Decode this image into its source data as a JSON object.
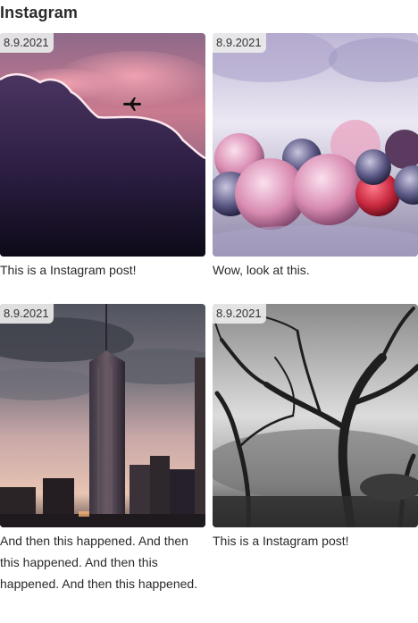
{
  "feed": {
    "title": "Instagram",
    "posts": [
      {
        "date": "8.9.2021",
        "caption": "This is a Instagram post!",
        "image": "sunset-clouds-airplane"
      },
      {
        "date": "8.9.2021",
        "caption": "Wow, look at this.",
        "image": "frozen-berries"
      },
      {
        "date": "8.9.2021",
        "caption": "And then this happened. And then this happened. And then this happened. And then this happened.",
        "image": "city-skyscraper-dusk"
      },
      {
        "date": "8.9.2021",
        "caption": "This is a Instagram post!",
        "image": "black-white-trees"
      }
    ]
  }
}
